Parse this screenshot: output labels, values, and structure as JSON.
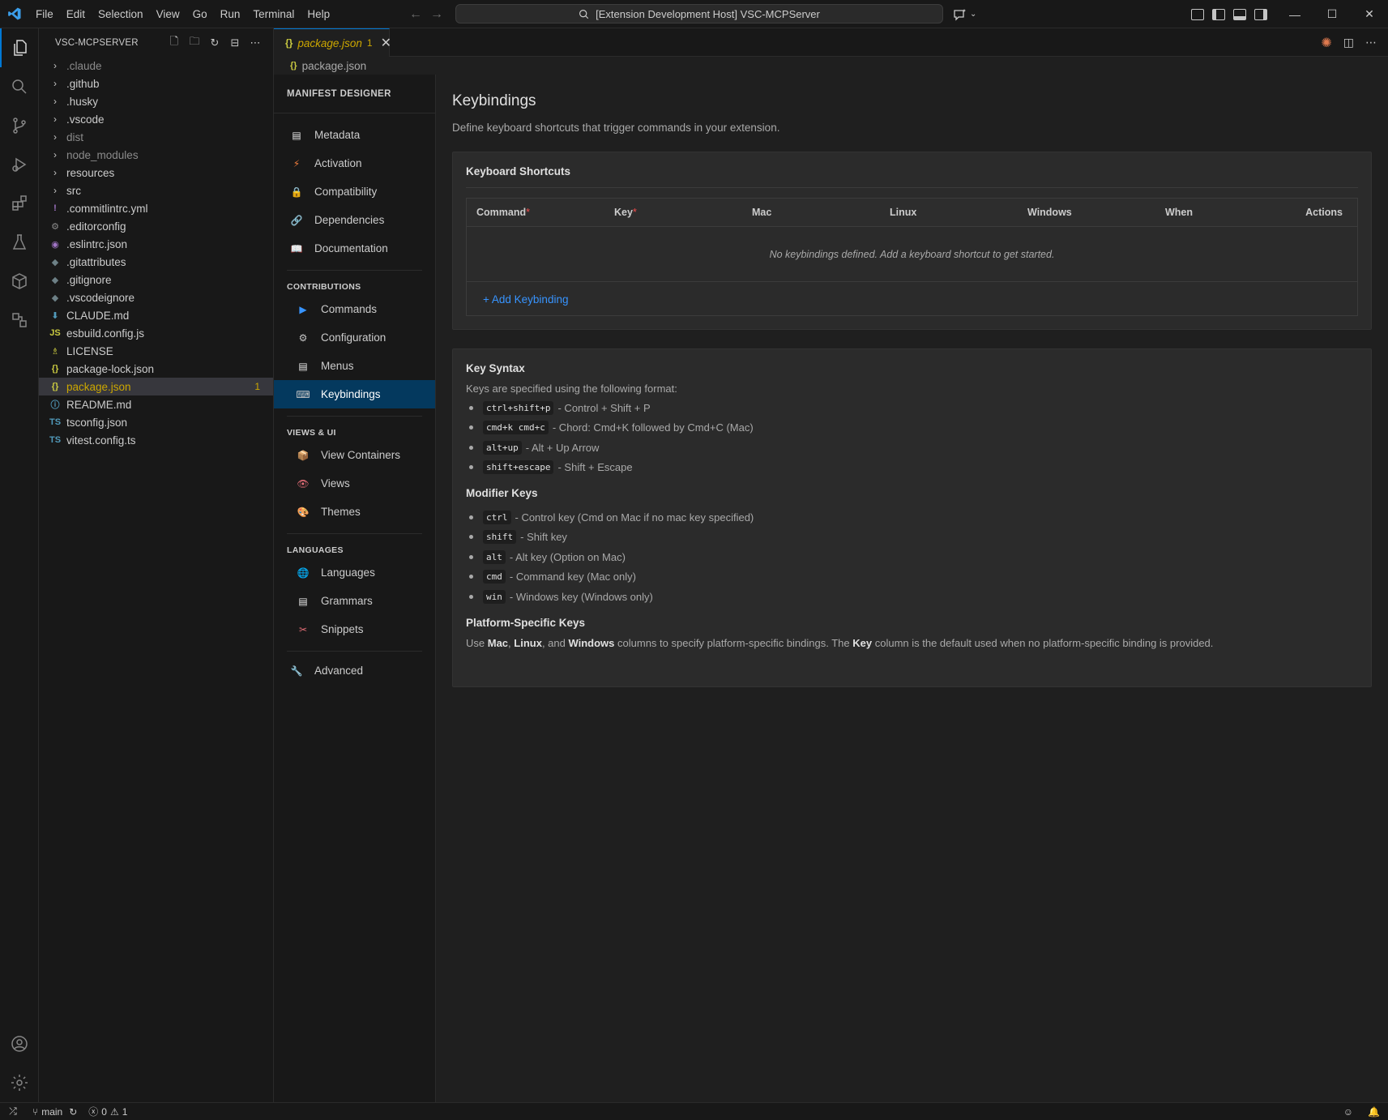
{
  "titlebar": {
    "menu": [
      "File",
      "Edit",
      "Selection",
      "View",
      "Go",
      "Run",
      "Terminal",
      "Help"
    ],
    "search_text": "[Extension Development Host] VSC-MCPServer"
  },
  "explorer": {
    "title": "VSC-MCPSERVER",
    "items": [
      {
        "name": ".claude",
        "type": "folder",
        "dim": true
      },
      {
        "name": ".github",
        "type": "folder"
      },
      {
        "name": ".husky",
        "type": "folder"
      },
      {
        "name": ".vscode",
        "type": "folder"
      },
      {
        "name": "dist",
        "type": "folder",
        "dim": true
      },
      {
        "name": "node_modules",
        "type": "folder",
        "dim": true
      },
      {
        "name": "resources",
        "type": "folder"
      },
      {
        "name": "src",
        "type": "folder"
      },
      {
        "name": ".commitlintrc.yml",
        "type": "file",
        "icon": "!",
        "icon_color": "#a074c4"
      },
      {
        "name": ".editorconfig",
        "type": "file",
        "icon": "⚙",
        "icon_color": "#8b8b8b"
      },
      {
        "name": ".eslintrc.json",
        "type": "file",
        "icon": "◉",
        "icon_color": "#a074c4"
      },
      {
        "name": ".gitattributes",
        "type": "file",
        "icon": "◆",
        "icon_color": "#6d8086"
      },
      {
        "name": ".gitignore",
        "type": "file",
        "icon": "◆",
        "icon_color": "#6d8086"
      },
      {
        "name": ".vscodeignore",
        "type": "file",
        "icon": "◆",
        "icon_color": "#6d8086"
      },
      {
        "name": "CLAUDE.md",
        "type": "file",
        "icon": "⬇",
        "icon_color": "#519aba"
      },
      {
        "name": "esbuild.config.js",
        "type": "file",
        "icon": "JS",
        "icon_color": "#cbcb41"
      },
      {
        "name": "LICENSE",
        "type": "file",
        "icon": "♗",
        "icon_color": "#cbcb41"
      },
      {
        "name": "package-lock.json",
        "type": "file",
        "icon": "{}",
        "icon_color": "#cbcb41"
      },
      {
        "name": "package.json",
        "type": "file",
        "icon": "{}",
        "icon_color": "#cbcb41",
        "selected": true,
        "badge": "1"
      },
      {
        "name": "README.md",
        "type": "file",
        "icon": "ⓘ",
        "icon_color": "#519aba"
      },
      {
        "name": "tsconfig.json",
        "type": "file",
        "icon": "TS",
        "icon_color": "#519aba"
      },
      {
        "name": "vitest.config.ts",
        "type": "file",
        "icon": "TS",
        "icon_color": "#519aba"
      }
    ]
  },
  "tab": {
    "icon": "{}",
    "name": "package.json",
    "count": "1"
  },
  "breadcrumb": {
    "icon": "{}",
    "label": "package.json"
  },
  "designer": {
    "title": "MANIFEST DESIGNER",
    "top_items": [
      {
        "label": "Metadata",
        "icon": "▤",
        "icon_color": "#e8e8e8"
      },
      {
        "label": "Activation",
        "icon": "⚡",
        "icon_color": "#f07c3c"
      },
      {
        "label": "Compatibility",
        "icon": "🔒",
        "icon_color": "#e5b94c"
      },
      {
        "label": "Dependencies",
        "icon": "🔗",
        "icon_color": "#c5c5c5"
      },
      {
        "label": "Documentation",
        "icon": "📖",
        "icon_color": "#c5c5c5"
      }
    ],
    "sections": [
      {
        "title": "CONTRIBUTIONS",
        "items": [
          {
            "label": "Commands",
            "icon": "▶",
            "icon_color": "#3794ff"
          },
          {
            "label": "Configuration",
            "icon": "⚙",
            "icon_color": "#c5c5c5"
          },
          {
            "label": "Menus",
            "icon": "▤",
            "icon_color": "#e8e8e8"
          },
          {
            "label": "Keybindings",
            "icon": "⌨",
            "icon_color": "#c5c5c5",
            "active": true
          }
        ]
      },
      {
        "title": "VIEWS & UI",
        "items": [
          {
            "label": "View Containers",
            "icon": "📦",
            "icon_color": "#d4a04c"
          },
          {
            "label": "Views",
            "icon": "👁",
            "icon_color": "#e06c75"
          },
          {
            "label": "Themes",
            "icon": "🎨",
            "icon_color": "#e06c75"
          }
        ]
      },
      {
        "title": "LANGUAGES",
        "items": [
          {
            "label": "Languages",
            "icon": "🌐",
            "icon_color": "#3794ff"
          },
          {
            "label": "Grammars",
            "icon": "▤",
            "icon_color": "#e8e8e8"
          },
          {
            "label": "Snippets",
            "icon": "✂",
            "icon_color": "#e06c75"
          }
        ]
      }
    ],
    "advanced": {
      "label": "Advanced",
      "icon": "🔧",
      "icon_color": "#c5c5c5"
    }
  },
  "main": {
    "title": "Keybindings",
    "subtitle": "Define keyboard shortcuts that trigger commands in your extension.",
    "shortcuts": {
      "title": "Keyboard Shortcuts",
      "columns": [
        {
          "label": "Command",
          "required": true
        },
        {
          "label": "Key",
          "required": true
        },
        {
          "label": "Mac",
          "required": false
        },
        {
          "label": "Linux",
          "required": false
        },
        {
          "label": "Windows",
          "required": false
        },
        {
          "label": "When",
          "required": false
        }
      ],
      "actions_label": "Actions",
      "empty": "No keybindings defined. Add a keyboard shortcut to get started.",
      "add_label": "+ Add Keybinding"
    },
    "syntax": {
      "key_syntax_title": "Key Syntax",
      "key_syntax_intro": "Keys are specified using the following format:",
      "key_examples": [
        {
          "code": "ctrl+shift+p",
          "desc": "- Control + Shift + P"
        },
        {
          "code": "cmd+k cmd+c",
          "desc": "- Chord: Cmd+K followed by Cmd+C (Mac)"
        },
        {
          "code": "alt+up",
          "desc": "- Alt + Up Arrow"
        },
        {
          "code": "shift+escape",
          "desc": "- Shift + Escape"
        }
      ],
      "modifier_title": "Modifier Keys",
      "modifiers": [
        {
          "code": "ctrl",
          "desc": "- Control key (Cmd on Mac if no mac key specified)"
        },
        {
          "code": "shift",
          "desc": "- Shift key"
        },
        {
          "code": "alt",
          "desc": "- Alt key (Option on Mac)"
        },
        {
          "code": "cmd",
          "desc": "- Command key (Mac only)"
        },
        {
          "code": "win",
          "desc": "- Windows key (Windows only)"
        }
      ],
      "platform_title": "Platform-Specific Keys",
      "platform_parts": {
        "p1": "Use ",
        "b1": "Mac",
        "p2": ", ",
        "b2": "Linux",
        "p3": ", and ",
        "b3": "Windows",
        "p4": " columns to specify platform-specific bindings. The ",
        "b4": "Key",
        "p5": " column is the default used when no platform-specific binding is provided."
      }
    }
  },
  "statusbar": {
    "branch": "main",
    "errors": "0",
    "warnings": "1"
  }
}
